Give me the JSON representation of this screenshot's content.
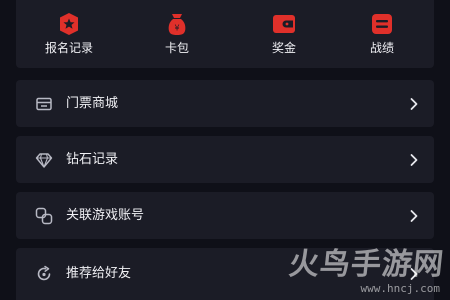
{
  "colors": {
    "background": "#0f1018",
    "card": "#1b1c26",
    "accent_red": "#e0302a",
    "text": "#f0f0f4",
    "icon_gray": "#b8b9c4"
  },
  "shortcuts": [
    {
      "label": "报名记录",
      "icon": "star-badge-icon"
    },
    {
      "label": "卡包",
      "icon": "wallet-bag-icon"
    },
    {
      "label": "奖金",
      "icon": "wallet-icon"
    },
    {
      "label": "战绩",
      "icon": "record-list-icon"
    }
  ],
  "menu": [
    {
      "label": "门票商城",
      "icon": "ticket-shop-icon"
    },
    {
      "label": "钻石记录",
      "icon": "diamond-icon"
    },
    {
      "label": "关联游戏账号",
      "icon": "link-icon"
    },
    {
      "label": "推荐给好友",
      "icon": "share-icon"
    }
  ],
  "watermark": {
    "title": "火鸟手游网",
    "url": "www.hncj.com"
  }
}
